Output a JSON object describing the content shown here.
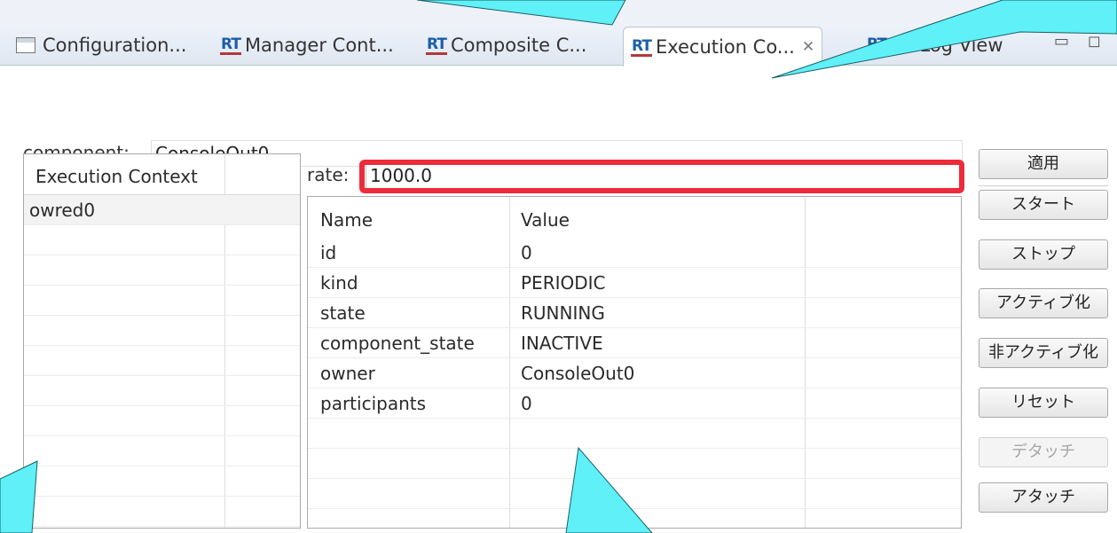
{
  "tabs": [
    {
      "label": "Configuration...",
      "icon": "config-view-icon"
    },
    {
      "label": "Manager Cont...",
      "icon": "rt-icon"
    },
    {
      "label": "Composite C...",
      "icon": "rt-icon"
    },
    {
      "label": "Execution Co...",
      "icon": "rt-icon",
      "active": true
    },
    {
      "label": "RT Log View",
      "icon": "rt-icon"
    }
  ],
  "rt_icon_text": "RT",
  "close_glyph": "✕",
  "window_controls": {
    "minimize": "▭",
    "maximize": "◻"
  },
  "component": {
    "label": "component:",
    "value": "ConsoleOut0"
  },
  "rate": {
    "label": "rate:",
    "value": "1000.0"
  },
  "ec_list": {
    "header": "Execution Context",
    "items": [
      "owred0"
    ]
  },
  "props": {
    "headers": [
      "Name",
      "Value"
    ],
    "rows": [
      {
        "name": "id",
        "value": "0"
      },
      {
        "name": "kind",
        "value": "PERIODIC"
      },
      {
        "name": "state",
        "value": "RUNNING"
      },
      {
        "name": "component_state",
        "value": "INACTIVE"
      },
      {
        "name": "owner",
        "value": "ConsoleOut0"
      },
      {
        "name": "participants",
        "value": "0"
      }
    ]
  },
  "buttons": {
    "apply": "適用",
    "start": "スタート",
    "stop": "ストップ",
    "activate": "アクティブ化",
    "deactivate": "非アクティブ化",
    "reset": "リセット",
    "detach": "デタッチ",
    "attach": "アタッチ"
  },
  "colors": {
    "highlight": "#ee2b3b",
    "callout": "#5ff0f8",
    "rt_logo": "#1c5ea8"
  }
}
